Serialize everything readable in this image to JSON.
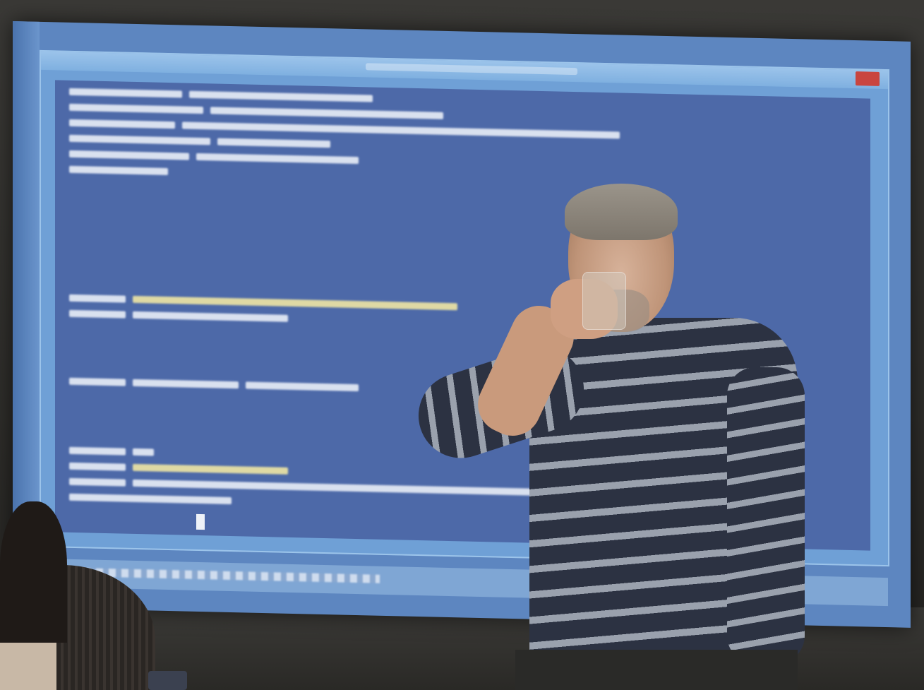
{
  "scene": {
    "description_tags": [
      "presentation-screen",
      "powershell-console",
      "presenter",
      "audience"
    ]
  },
  "console": {
    "colors": {
      "background": "#4d69a8",
      "text": "#eef2f8",
      "comment": "#efe6a4"
    }
  }
}
